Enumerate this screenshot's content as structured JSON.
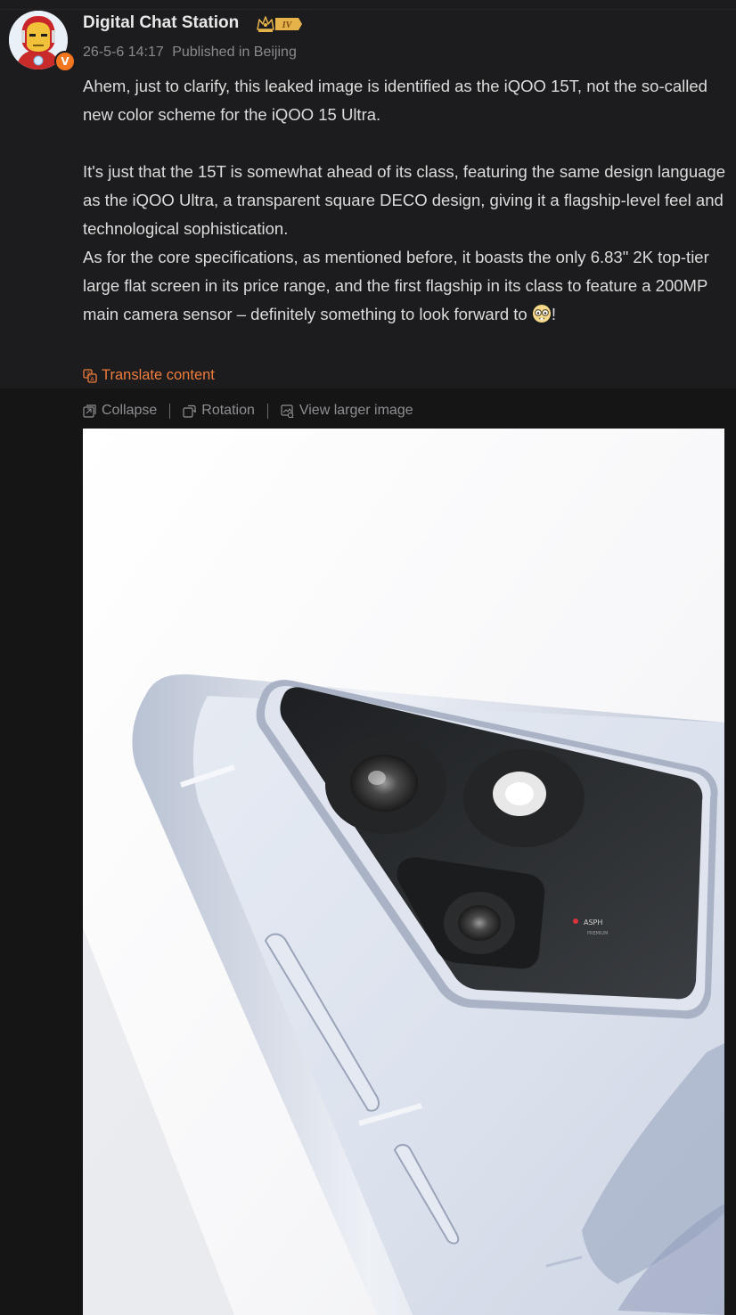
{
  "user": {
    "name": "Digital Chat Station",
    "level_badge": "IV",
    "verified_mark": "V"
  },
  "meta": {
    "date": "26-5-6 14:17",
    "location": "Published in Beijing"
  },
  "post": {
    "paragraph_1": "Ahem, just to clarify, this leaked image is identified as the iQOO 15T, not the so-called new color scheme for the iQOO 15 Ultra.",
    "paragraph_2": "It's just that the 15T is somewhat ahead of its class, featuring the same design language as the iQOO Ultra, a transparent square DECO design, giving it a flagship-level feel and technological sophistication.",
    "paragraph_3": "As for the core specifications, as mentioned before, it boasts the only 6.83\" 2K top-tier large flat screen in its price range, and the first flagship in its class to feature a 200MP main camera sensor – definitely something to look forward to",
    "paragraph_3_end": "!",
    "emoji_icon": "nerd-face-emoji-icon"
  },
  "actions": {
    "translate_label": "Translate content",
    "translate_icon": "translate-icon"
  },
  "image_toolbar": {
    "collapse_label": "Collapse",
    "rotation_label": "Rotation",
    "view_larger_label": "View larger image"
  },
  "image": {
    "camera_label": "ASPH",
    "camera_sublabel": "PREMIUM"
  },
  "colors": {
    "background": "#151515",
    "card": "#1c1c1e",
    "accent": "#ef7d3c",
    "text": "#dcdcdc",
    "muted": "#8a8a8e"
  }
}
